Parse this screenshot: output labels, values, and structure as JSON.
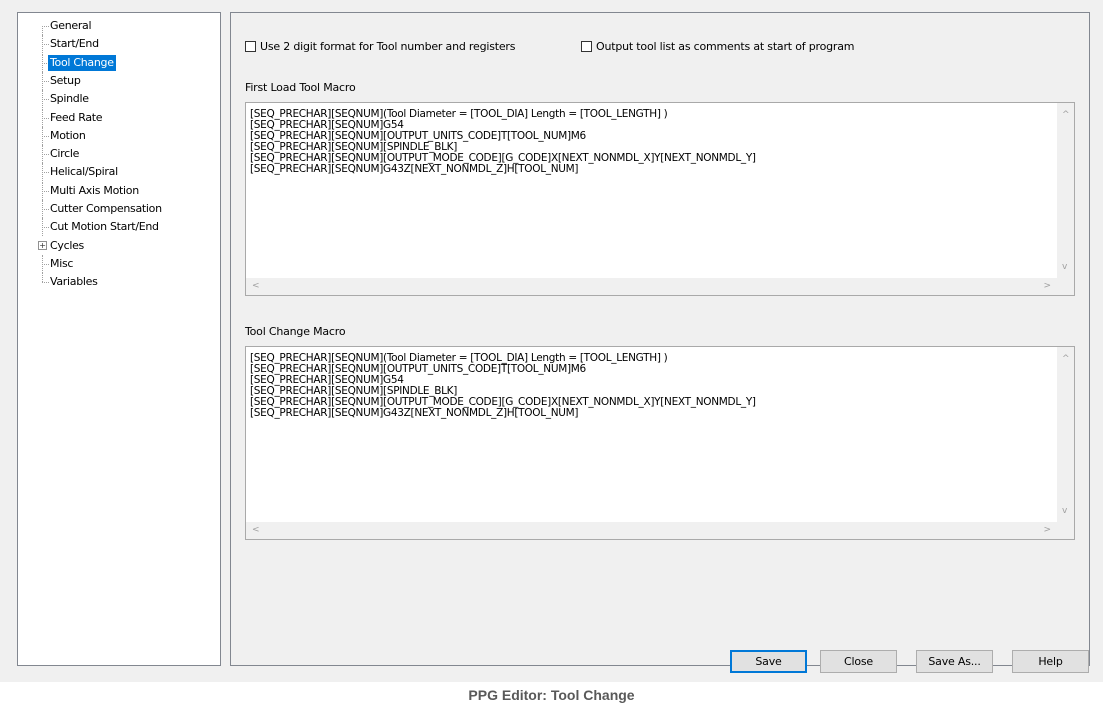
{
  "tree": {
    "items": [
      {
        "label": "General",
        "selected": false
      },
      {
        "label": "Start/End",
        "selected": false
      },
      {
        "label": "Tool Change",
        "selected": true
      },
      {
        "label": "Setup",
        "selected": false
      },
      {
        "label": "Spindle",
        "selected": false
      },
      {
        "label": "Feed Rate",
        "selected": false
      },
      {
        "label": "Motion",
        "selected": false
      },
      {
        "label": "Circle",
        "selected": false
      },
      {
        "label": "Helical/Spiral",
        "selected": false
      },
      {
        "label": "Multi Axis Motion",
        "selected": false
      },
      {
        "label": "Cutter Compensation",
        "selected": false
      },
      {
        "label": "Cut Motion Start/End",
        "selected": false
      },
      {
        "label": "Cycles",
        "selected": false,
        "expandable": true,
        "expander": "+"
      },
      {
        "label": "Misc",
        "selected": false
      },
      {
        "label": "Variables",
        "selected": false
      }
    ]
  },
  "options": {
    "two_digit_label": "Use 2 digit format for Tool number and registers",
    "two_digit_checked": false,
    "tool_list_label": "Output tool list as comments at start of program",
    "tool_list_checked": false
  },
  "first_load": {
    "label": "First Load Tool Macro",
    "lines": [
      "[SEQ_PRECHAR][SEQNUM](Tool Diameter = [TOOL_DIA] Length = [TOOL_LENGTH] )",
      "[SEQ_PRECHAR][SEQNUM]G54",
      "[SEQ_PRECHAR][SEQNUM][OUTPUT_UNITS_CODE]T[TOOL_NUM]M6",
      "[SEQ_PRECHAR][SEQNUM][SPINDLE_BLK]",
      "[SEQ_PRECHAR][SEQNUM][OUTPUT_MODE_CODE][G_CODE]X[NEXT_NONMDL_X]Y[NEXT_NONMDL_Y]",
      "[SEQ_PRECHAR][SEQNUM]G43Z[NEXT_NONMDL_Z]H[TOOL_NUM]"
    ]
  },
  "tool_change": {
    "label": "Tool Change Macro",
    "lines": [
      "[SEQ_PRECHAR][SEQNUM](Tool Diameter = [TOOL_DIA] Length = [TOOL_LENGTH] )",
      "[SEQ_PRECHAR][SEQNUM][OUTPUT_UNITS_CODE]T[TOOL_NUM]M6",
      "[SEQ_PRECHAR][SEQNUM]G54",
      "[SEQ_PRECHAR][SEQNUM][SPINDLE_BLK]",
      "[SEQ_PRECHAR][SEQNUM][OUTPUT_MODE_CODE][G_CODE]X[NEXT_NONMDL_X]Y[NEXT_NONMDL_Y]",
      "[SEQ_PRECHAR][SEQNUM]G43Z[NEXT_NONMDL_Z]H[TOOL_NUM]"
    ]
  },
  "scroll": {
    "up": "^",
    "down": "v",
    "left": "<",
    "right": ">"
  },
  "buttons": {
    "save": "Save",
    "close": "Close",
    "save_as": "Save As...",
    "help": "Help"
  },
  "colors": {
    "selection": "#0078d7",
    "default_button_border": "#0078d7"
  },
  "caption": "PPG Editor: Tool Change"
}
